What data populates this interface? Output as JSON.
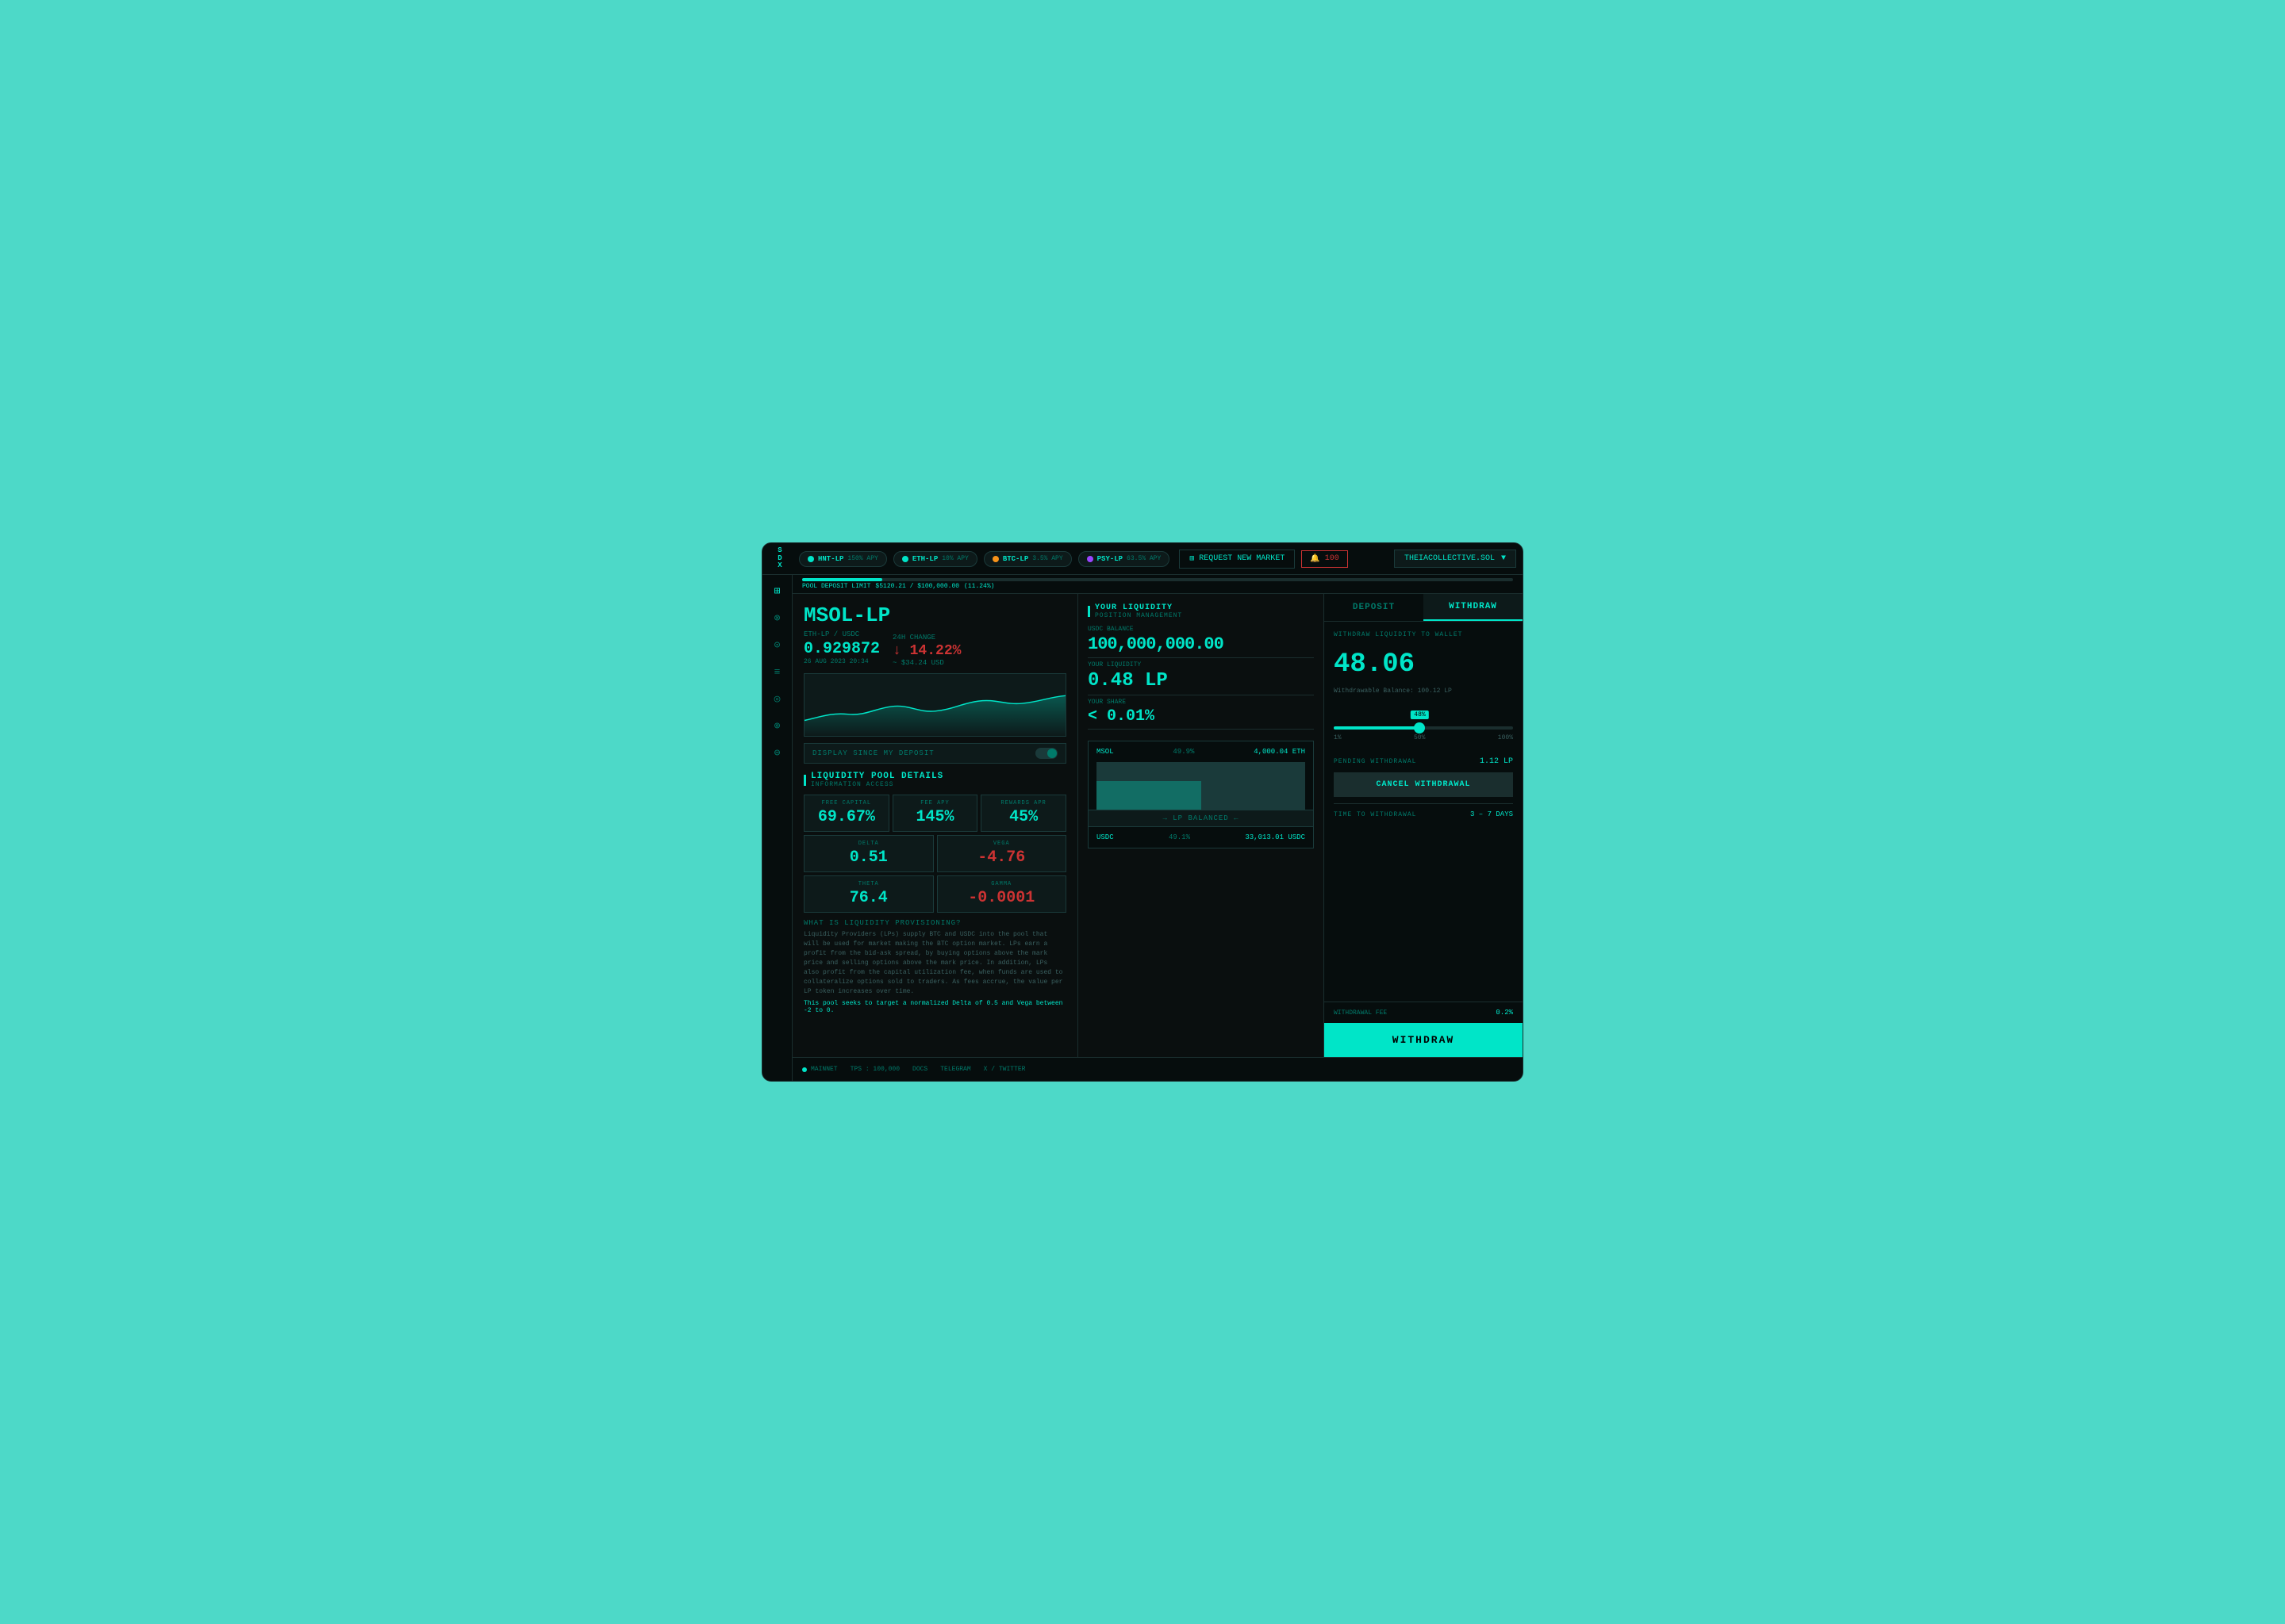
{
  "app": {
    "title": "SDX"
  },
  "topnav": {
    "pools": [
      {
        "name": "HNT-LP",
        "apy": "150% APY",
        "color": "#00e5c8"
      },
      {
        "name": "ETH-LP",
        "apy": "10% APY",
        "color": "#00e5c8"
      },
      {
        "name": "BTC-LP",
        "apy": "3.5% APY",
        "color": "#f7931a"
      },
      {
        "name": "PSY-LP",
        "apy": "63.5% APY",
        "color": "#9945ff"
      }
    ],
    "request_market_label": "REQUEST NEW MARKET",
    "score_label": "100",
    "wallet_label": "THEIACOLLECTIVE.SOL"
  },
  "deposit_limit": {
    "label": "POOL DEPOSIT LIMIT",
    "current": "$5120.21 / $100,000.00",
    "pct": "(11.24%)",
    "fill_pct": 11.24
  },
  "market": {
    "pool_name": "MSOL-LP",
    "pair": "ETH-LP / USDC",
    "price": "0.929872",
    "change_label": "24H CHANGE",
    "change_value": "↓ 14.22%",
    "timestamp": "26 AUG 2023 20:34",
    "usd_approx": "~ $34.24 USD"
  },
  "toggle": {
    "label": "DISPLAY SINCE MY DEPOSIT"
  },
  "pool_details": {
    "title": "LIQUIDITY POOL DETAILS",
    "subtitle": "INFORMATION ACCESS",
    "free_capital_label": "FREE CAPITAL",
    "free_capital_value": "69.67%",
    "fee_apy_label": "FEE APY",
    "fee_apy_value": "145%",
    "rewards_apr_label": "REWARDS APR",
    "rewards_apr_value": "45%",
    "delta_label": "DELTA",
    "delta_value": "0.51",
    "vega_label": "VEGA",
    "vega_value": "-4.76",
    "theta_label": "THETA",
    "theta_value": "76.4",
    "gamma_label": "GAMMA",
    "gamma_value": "-0.0001"
  },
  "info": {
    "title": "WHAT IS LIQUIDITY PROVISIONING?",
    "body": "Liquidity Providers (LPs) supply BTC and USDC into the pool that will be used for market making the BTC option market. LPs earn a profit from the bid-ask spread, by buying options above the mark price and selling options above the mark price. In addition, LPs also profit from the capital utilization fee, when funds are used to collateralize options sold to traders. As fees accrue, the value per LP token increases over time.",
    "highlight": "This pool seeks to target a normalized Delta of 0.5 and Vega between -2 to 0."
  },
  "liquidity": {
    "section_label": "YOUR LIQUIDITY",
    "position_label": "POSITION MANAGEMENT",
    "usdc_balance_label": "USDC BALANCE",
    "usdc_balance_value": "100,000,000.00",
    "your_liquidity_label": "YOUR LIQUIDITY",
    "your_liquidity_value": "0.48 LP",
    "your_share_label": "YOUR SHARE",
    "your_share_value": "< 0.01%",
    "composition": {
      "token1_name": "MSOL",
      "token1_pct": "49.9%",
      "token1_val": "4,000.04 ETH",
      "token2_name": "USDC",
      "token2_pct": "49.1%",
      "token2_val": "33,013.01 USDC",
      "balanced_label": "→ LP BALANCED ←"
    }
  },
  "withdraw": {
    "deposit_tab": "DEPOSIT",
    "withdraw_tab": "WITHDRAW",
    "section_label": "WITHDRAW LIQUIDITY TO WALLET",
    "amount": "48.06",
    "withdrawable": "Withdrawable Balance: 100.12 LP",
    "slider_pct": 48,
    "slider_label": "48%",
    "slider_min": "1%",
    "slider_mid": "50%",
    "slider_max": "100%",
    "pending_label": "PENDING WITHDRAWAL",
    "pending_value": "1.12 LP",
    "cancel_label": "CANCEL WITHDRAWAL",
    "time_label": "TIME TO WITHDRAWAL",
    "time_value": "3 – 7 DAYS",
    "fee_label": "WITHDRAWAL FEE",
    "fee_value": "0.2%",
    "withdraw_btn": "WITHDRAW"
  },
  "footer": {
    "network": "MAINNET",
    "tps": "TPS : 100,000",
    "docs": "DOCS",
    "telegram": "TELEGRAM",
    "twitter": "X / TWITTER"
  },
  "sidebar": {
    "icons": [
      "⊞",
      "⊗",
      "⊙",
      "⊘",
      "◎",
      "⊚",
      "⊜"
    ]
  }
}
